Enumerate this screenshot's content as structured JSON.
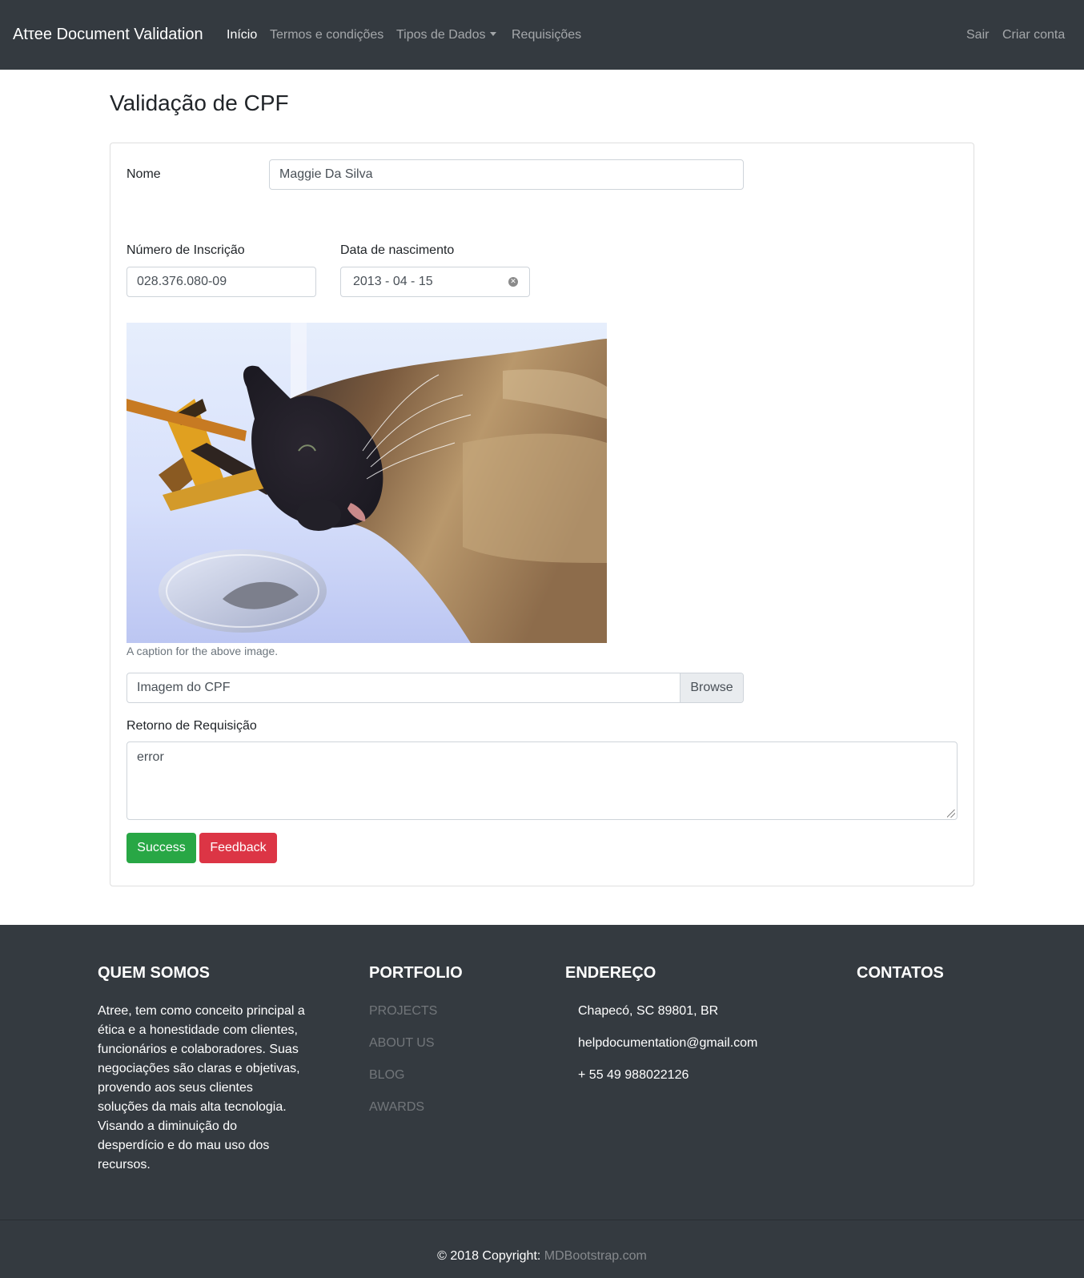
{
  "navbar": {
    "brand": "Atτee Document Validation",
    "links": [
      {
        "label": "Início",
        "active": true
      },
      {
        "label": "Termos e condições"
      },
      {
        "label": "Tipos de Dados"
      },
      {
        "label": "Requisições"
      }
    ],
    "right_links": [
      {
        "label": "Sair"
      },
      {
        "label": "Criar conta"
      }
    ]
  },
  "page": {
    "title": "Validação de CPF"
  },
  "form": {
    "name_label": "Nome",
    "name_value": "Maggie Da Silva",
    "registration_label": "Número de Inscrição",
    "registration_value": "028.376.080-09",
    "birthdate_label": "Data de nascimento",
    "birthdate_value": "2013 - 04 - 15",
    "image_caption": "A caption for the above image.",
    "file_label": "Imagem do CPF",
    "file_button": "Browse",
    "response_label": "Retorno de Requisição",
    "response_value": "error",
    "success_button": "Success",
    "feedback_button": "Feedback"
  },
  "footer": {
    "about_heading": "QUEM SOMOS",
    "about_text": "Atree, tem como conceito principal a ética e a honestidade com clientes, funcionários e colaboradores. Suas negociações são claras e objetivas, provendo aos seus clientes soluções da mais alta tecnologia. Visando a diminuição do desperdício e do mau uso dos recursos.",
    "portfolio_heading": "PORTFOLIO",
    "portfolio_links": [
      "PROJECTS",
      "ABOUT US",
      "BLOG",
      "AWARDS"
    ],
    "address_heading": "ENDEREÇO",
    "address_lines": [
      "Chapecó, SC 89801, BR",
      "helpdocumentation@gmail.com",
      "+ 55 49 988022126"
    ],
    "contacts_heading": "CONTATOS",
    "copyright_prefix": "© 2018 Copyright:",
    "copyright_link": "MDBootstrap.com"
  },
  "colors": {
    "navbar_bg": "#343a40",
    "success": "#28a745",
    "danger": "#dc3545"
  }
}
